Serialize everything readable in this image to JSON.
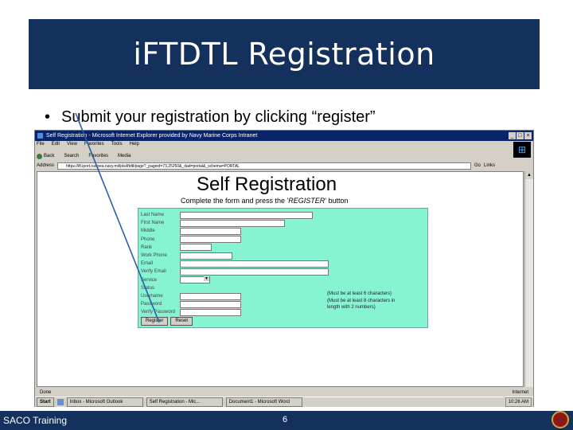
{
  "slide": {
    "title": "iFTDTL Registration",
    "bullet_mark": "•",
    "bullet_text": "Submit your registration by clicking “register”",
    "footer_left": "SACO Training",
    "page_number": "6"
  },
  "browser": {
    "window_title": "Self Registration - Microsoft Internet Explorer provided by Navy Marine Corps Intranet",
    "menu": [
      "File",
      "Edit",
      "View",
      "Favorites",
      "Tools",
      "Help"
    ],
    "toolbar": [
      "Back",
      "Search",
      "Favorites",
      "Media"
    ],
    "address_label": "Address",
    "address_url": "https://ift.iport.navsea.navy.mil/pls/iftdtl/page?_pageid=73,25250&_dad=portal&_schema=PORTAL",
    "go_label": "Go",
    "links_label": "Links",
    "status_left": "Done",
    "status_right": "Internet"
  },
  "page": {
    "heading": "Self Registration",
    "instructions_pre": "Complete the form and press the '",
    "instructions_em": "REGISTER",
    "instructions_post": "' button",
    "fields": [
      {
        "label": "Last Name",
        "kind": "input"
      },
      {
        "label": "First Name",
        "kind": "input"
      },
      {
        "label": "Middle",
        "kind": "input"
      },
      {
        "label": "Phone",
        "kind": "input"
      },
      {
        "label": "Rank",
        "kind": "input"
      },
      {
        "label": "Work Phone",
        "kind": "input"
      },
      {
        "label": "Email",
        "kind": "input"
      },
      {
        "label": "Verify Email",
        "kind": "input"
      },
      {
        "label": "Service",
        "kind": "select"
      },
      {
        "label": "Status",
        "kind": "none"
      },
      {
        "label": "Username",
        "kind": "input"
      },
      {
        "label": "Password",
        "kind": "input"
      },
      {
        "label": "Verify Password",
        "kind": "input"
      }
    ],
    "username_hint": "(Must be at least 6 characters)",
    "password_hint_1": "(Must be at least 8 characters in",
    "password_hint_2": "length with 2 numbers)",
    "register_button": "Register",
    "reset_button": "Reset"
  },
  "taskbar": {
    "start": "Start",
    "tasks": [
      "Inbox - Microsoft Outlook",
      "Self Registration - Mic...",
      "Document1 - Microsoft Word"
    ],
    "clock": "10:26 AM"
  }
}
